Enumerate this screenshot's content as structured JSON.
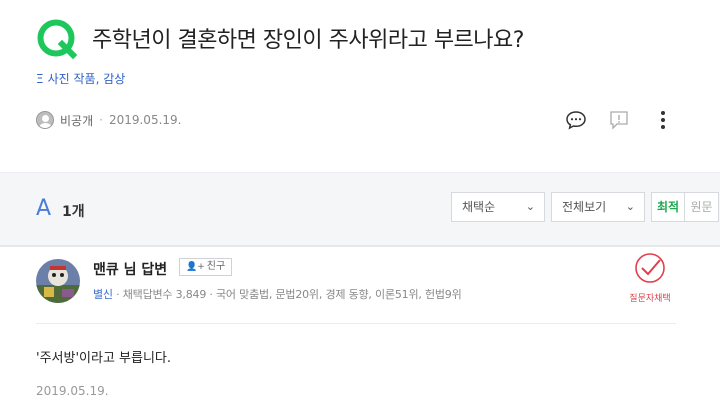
{
  "question": {
    "title": "주학년이 결혼하면 장인이 주사위라고 부르나요?",
    "category_mark": "Ξ",
    "category": "사진 작품, 감상",
    "author": "비공개",
    "date": "2019.05.19."
  },
  "icons": {
    "q_logo": "q-logo-icon",
    "comment": "comment-icon",
    "report": "report-icon",
    "more": "more-vertical-icon"
  },
  "answer_bar": {
    "letter": "A",
    "count": "1개",
    "sort_select": "채택순",
    "view_select": "전체보기",
    "toggle_on": "최적",
    "toggle_off": "원문"
  },
  "answer": {
    "name": "맨큐 님 답변",
    "friend_button": "친구",
    "rank": "별신",
    "meta": "· 채택답변수 3,849 · 국어 맞춤법, 문법20위, 경제 동향, 이론51위, 헌법9위",
    "select_label": "질문자채택",
    "text": "'주서방'이라고 부릅니다.",
    "date": "2019.05.19."
  },
  "colors": {
    "brand_green": "#1fa84e",
    "link_blue": "#2f62c9",
    "select_red": "#e0414b"
  }
}
